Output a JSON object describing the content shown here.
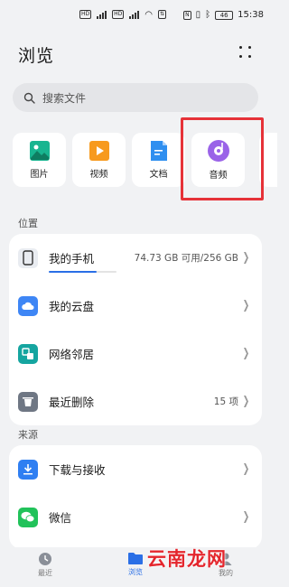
{
  "status_bar": {
    "time": "15:38",
    "battery": "46"
  },
  "header": {
    "title": "浏览"
  },
  "search": {
    "placeholder": "搜索文件"
  },
  "tiles": [
    {
      "label": "图片",
      "icon": "image-icon"
    },
    {
      "label": "视频",
      "icon": "video-icon"
    },
    {
      "label": "文档",
      "icon": "document-icon"
    },
    {
      "label": "音频",
      "icon": "audio-icon"
    }
  ],
  "location": {
    "label": "位置",
    "items": [
      {
        "label": "我的手机",
        "icon": "phone-icon",
        "meta": "74.73 GB 可用/256 GB",
        "storage_used_fraction": 0.71
      },
      {
        "label": "我的云盘",
        "icon": "cloud-drive-icon",
        "meta": ""
      },
      {
        "label": "网络邻居",
        "icon": "network-icon",
        "meta": ""
      },
      {
        "label": "最近删除",
        "icon": "trash-icon",
        "meta": "15 项"
      }
    ]
  },
  "sources": {
    "label": "来源",
    "items": [
      {
        "label": "下载与接收",
        "icon": "download-icon"
      },
      {
        "label": "微信",
        "icon": "wechat-icon"
      }
    ]
  },
  "nav": [
    {
      "label": "最近",
      "icon": "clock-icon",
      "active": false
    },
    {
      "label": "浏览",
      "icon": "folder-icon",
      "active": true
    },
    {
      "label": "我的",
      "icon": "person-icon",
      "active": false
    }
  ],
  "watermark": "云南龙网",
  "colors": {
    "accent": "#2a6fe6",
    "highlight": "#e63238"
  }
}
